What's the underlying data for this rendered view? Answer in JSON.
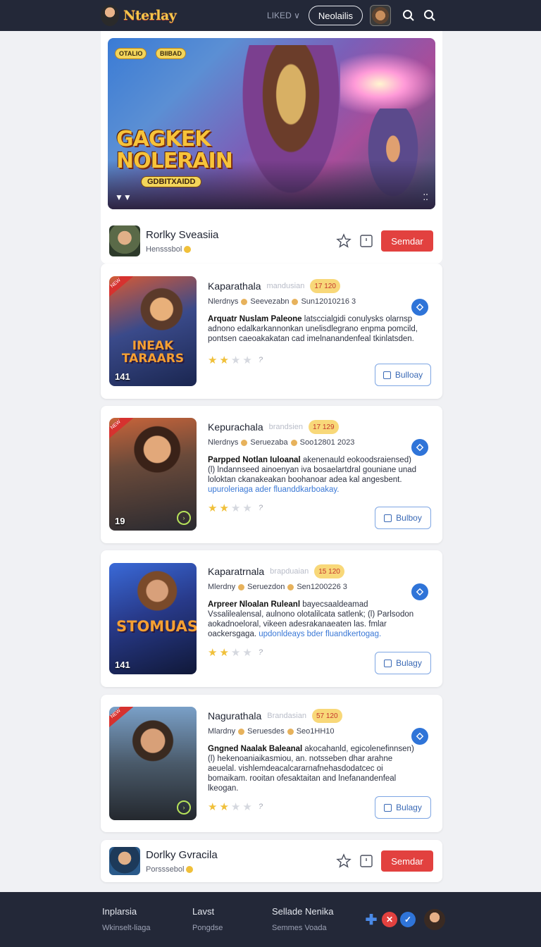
{
  "header": {
    "logo_text": "Nterlay",
    "menu_label": "LIKED ∨",
    "pill_label": "Neolailis"
  },
  "hero": {
    "badge_left": "OTALIO",
    "badge_right": "BIIBAD",
    "title_line1": "GAGKEK",
    "title_line2": "NOLERAIN",
    "subtitle": "GDBITXAIDD",
    "corner_left": "▼▼",
    "corner_right": "⁚⁚"
  },
  "creator_top": {
    "name": "Rorlky Sveasiia",
    "sub": "Hensssbol",
    "button": "Semdar"
  },
  "games": [
    {
      "title": "Kaparathala",
      "brand": "mandusian",
      "score": "17 120",
      "meta_left": "Nlerdnys",
      "meta_mid": "Seevezabn",
      "meta_right": "Sun12010216 3",
      "desc_lead": "Arquatr Nuslam Paleone",
      "desc_rest": " latsccialgidi conulysks olarnsp adnono edalkarkannonkan unelisdlegrano enpma pomcild, pontsen caeoakakatan cad imelnanandenfeal tkinlatsden.",
      "desc_link": "",
      "thumb_num": "141",
      "thumb_art": "INEAK TARAARS",
      "thumb_tag": "NEW",
      "rating": 2,
      "button": "Bulloay"
    },
    {
      "title": "Kepurachala",
      "brand": "brandsien",
      "score": "17 129",
      "meta_left": "Nlerdnys",
      "meta_mid": "Seruezaba",
      "meta_right": "Soo12801 2023",
      "desc_lead": "Parpped Notlan Iuloanal",
      "desc_rest": " akenenauld eokoodsraiensed) (l) lndannseed ainoenyan iva bosaelartdral gouniane unad loloktan ckanakeakan boohanoar adea kal angesbent.",
      "desc_link": "upuroleriaga ader fluanddkarboakay.",
      "thumb_num": "19",
      "thumb_art": "",
      "thumb_tag": "NEW",
      "rating": 2,
      "button": "Bulboy"
    },
    {
      "title": "Kaparatrnala",
      "brand": "brapduaian",
      "score": "15 120",
      "meta_left": "Mlerdny",
      "meta_mid": "Seruezdon",
      "meta_right": "Sen1200226 3",
      "desc_lead": "Arpreer Nloalan Ruleanl",
      "desc_rest": " bayecsaaldeamad Vssalilealensal, aulnono olotalilcata satlenk; (l) Parlsodon aokadnoeloral, vikeen adesrakanaeaten las. fmlar oackersgaga.",
      "desc_link": "updonldeays bder fluandkertogag.",
      "thumb_num": "141",
      "thumb_art": "STOMUAS",
      "thumb_tag": "",
      "rating": 2,
      "button": "Bulagy"
    },
    {
      "title": "Nagurathala",
      "brand": "Brandasian",
      "score": "57 120",
      "meta_left": "Mlardny",
      "meta_mid": "Seruesdes",
      "meta_right": "Seo1HH10",
      "desc_lead": "Gngned Naalak Baleanal",
      "desc_rest": " akocahanld, egicolenefinnsen) (l) hekenoaniaikasmiou, an. notsseben dhar arahne aeuelal. vishlemdeacalcararnafnehasdodatcec oi bomaikam. rooitan ofesaktaitan and lnefanandenfeal lkeogan.",
      "desc_link": "",
      "thumb_num": "",
      "thumb_art": "",
      "thumb_tag": "NEW",
      "rating": 2,
      "button": "Bulagy"
    }
  ],
  "creator_bottom": {
    "name": "Dorlky Gvracila",
    "sub": "Porsssebol",
    "button": "Semdar"
  },
  "footer": {
    "col1_head": "Inplarsia",
    "col1_link": "Wkinselt-liaga",
    "col2_head": "Lavst",
    "col2_link": "Pongdse",
    "col3_head": "Sellade Nenika",
    "col3_link": "Semmes Voada"
  },
  "colors": {
    "topbar": "#232838",
    "accent_red": "#e2413f",
    "accent_blue": "#2f74d8",
    "star": "#f0c03a"
  }
}
